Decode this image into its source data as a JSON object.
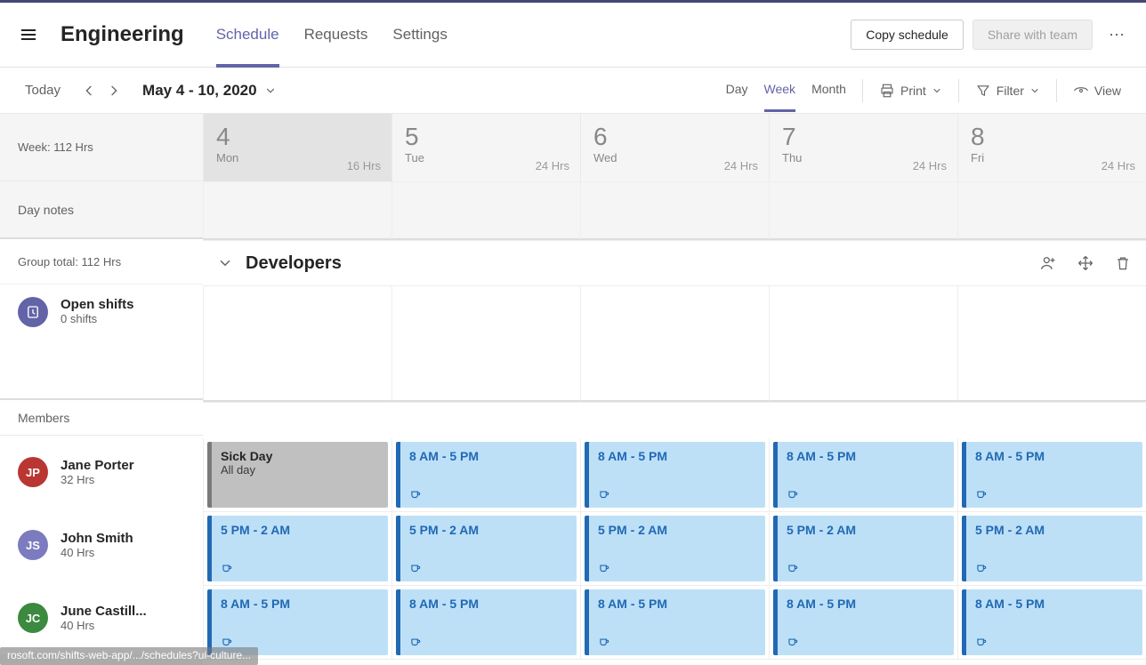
{
  "header": {
    "title": "Engineering",
    "tabs": [
      "Schedule",
      "Requests",
      "Settings"
    ],
    "active_tab": 0,
    "copy_label": "Copy schedule",
    "share_label": "Share with team"
  },
  "subheader": {
    "today": "Today",
    "date_range": "May 4 - 10, 2020",
    "views": {
      "day": "Day",
      "week": "Week",
      "month": "Month"
    },
    "active_view": "week",
    "print": "Print",
    "filter": "Filter",
    "view": "View"
  },
  "sidebar": {
    "week_hours": "Week: 112 Hrs",
    "day_notes": "Day notes",
    "group_total": "Group total: 112 Hrs",
    "open_label": "Open shifts",
    "open_sub": "0 shifts",
    "members_label": "Members",
    "members": [
      {
        "initials": "JP",
        "color": "#b93632",
        "name": "Jane Porter",
        "hours": "32 Hrs"
      },
      {
        "initials": "JS",
        "color": "#7c7bc0",
        "name": "John Smith",
        "hours": "40 Hrs"
      },
      {
        "initials": "JC",
        "color": "#3b8a3f",
        "name": "June Castill...",
        "hours": "40 Hrs"
      }
    ]
  },
  "days": [
    {
      "num": "4",
      "name": "Mon",
      "hrs": "16 Hrs",
      "past": true
    },
    {
      "num": "5",
      "name": "Tue",
      "hrs": "24 Hrs",
      "past": false
    },
    {
      "num": "6",
      "name": "Wed",
      "hrs": "24 Hrs",
      "past": false
    },
    {
      "num": "7",
      "name": "Thu",
      "hrs": "24 Hrs",
      "past": false
    },
    {
      "num": "8",
      "name": "Fri",
      "hrs": "24 Hrs",
      "past": false
    }
  ],
  "group": {
    "name": "Developers"
  },
  "shifts": {
    "sick": {
      "title": "Sick Day",
      "sub": "All day"
    },
    "morning": "8 AM - 5 PM",
    "evening": "5 PM - 2 AM"
  },
  "schedule": [
    [
      {
        "type": "gray",
        "title_key": "shifts.sick.title",
        "sub_key": "shifts.sick.sub"
      },
      {
        "type": "shift",
        "label_key": "shifts.morning"
      },
      {
        "type": "shift",
        "label_key": "shifts.morning"
      },
      {
        "type": "shift",
        "label_key": "shifts.morning"
      },
      {
        "type": "shift",
        "label_key": "shifts.morning"
      }
    ],
    [
      {
        "type": "shift",
        "label_key": "shifts.evening"
      },
      {
        "type": "shift",
        "label_key": "shifts.evening"
      },
      {
        "type": "shift",
        "label_key": "shifts.evening"
      },
      {
        "type": "shift",
        "label_key": "shifts.evening"
      },
      {
        "type": "shift",
        "label_key": "shifts.evening"
      }
    ],
    [
      {
        "type": "shift",
        "label_key": "shifts.morning"
      },
      {
        "type": "shift",
        "label_key": "shifts.morning"
      },
      {
        "type": "shift",
        "label_key": "shifts.morning"
      },
      {
        "type": "shift",
        "label_key": "shifts.morning"
      },
      {
        "type": "shift",
        "label_key": "shifts.morning"
      }
    ]
  ],
  "status_url": "rosoft.com/shifts-web-app/.../schedules?ui-culture..."
}
